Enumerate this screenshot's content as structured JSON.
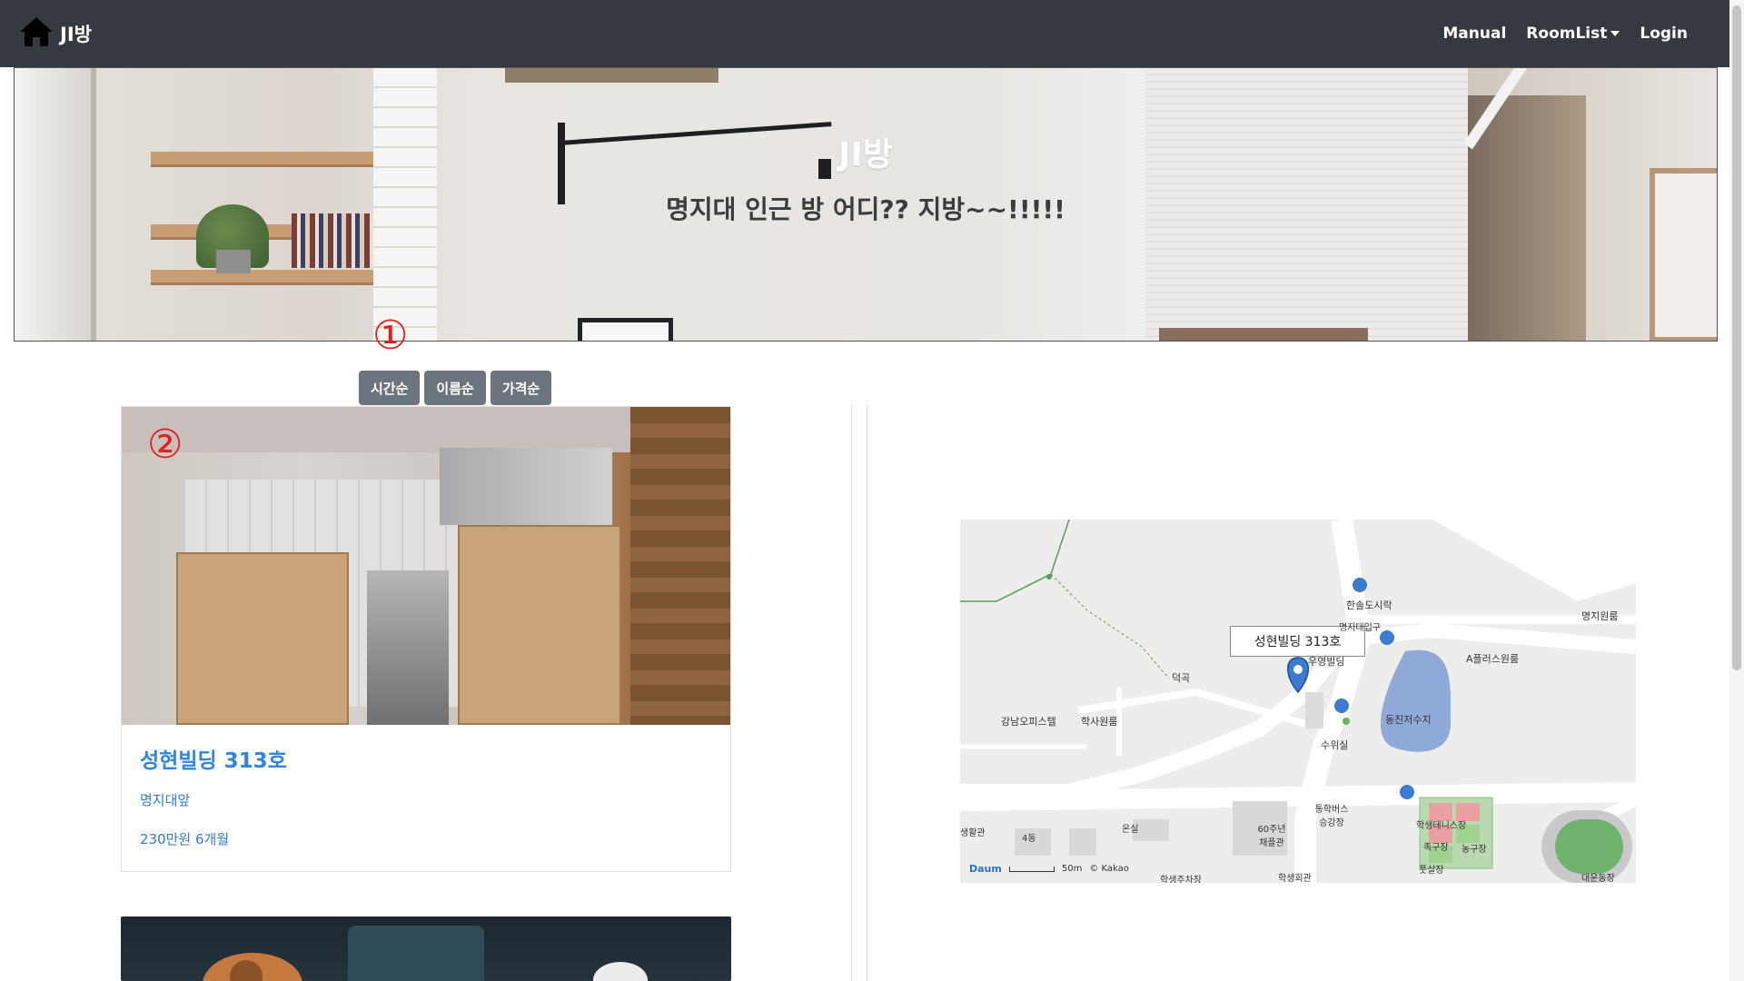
{
  "navbar": {
    "brand": "JI방",
    "links": [
      {
        "label": "Manual"
      },
      {
        "label": "RoomList"
      },
      {
        "label": "Login"
      }
    ]
  },
  "hero": {
    "title": "JI방",
    "subtitle": "명지대 인근 방 어디?? 지방~~!!!!!"
  },
  "annotations": [
    "①",
    "②"
  ],
  "sort_buttons": [
    "시간순",
    "이름순",
    "가격순"
  ],
  "rooms": [
    {
      "title": "성현빌딩 313호",
      "location": "명지대앞",
      "price": "230만원 6개월"
    }
  ],
  "map": {
    "tooltip": "성현빌딩 313호",
    "labels": {
      "l1": "한솔도시락",
      "l2": "명지원룸",
      "l3": "명지대입구",
      "l4": "우영빌딩",
      "l5": "A플러스원룸",
      "l6": "덕곡",
      "l7": "강남오피스텔",
      "l8": "학사원룸",
      "l9": "동진저수지",
      "l10": "수위실",
      "l11": "통학버스 승강장",
      "l12": "60주년 채플관",
      "l13": "학생테니스장",
      "l14": "족구장",
      "l15": "농구장",
      "l16": "풋살장",
      "l17": "학생주차장",
      "l18": "학생회관",
      "l19": "대운동장",
      "l20": "온실",
      "l21": "4동",
      "l22": "생활관"
    },
    "scale": "50m",
    "copyright": "© Kakao",
    "logo": "Daum"
  },
  "colors": {
    "navbar": "#343a40",
    "button": "#6c757d",
    "link": "#2e86de",
    "annotation": "#e02020"
  }
}
